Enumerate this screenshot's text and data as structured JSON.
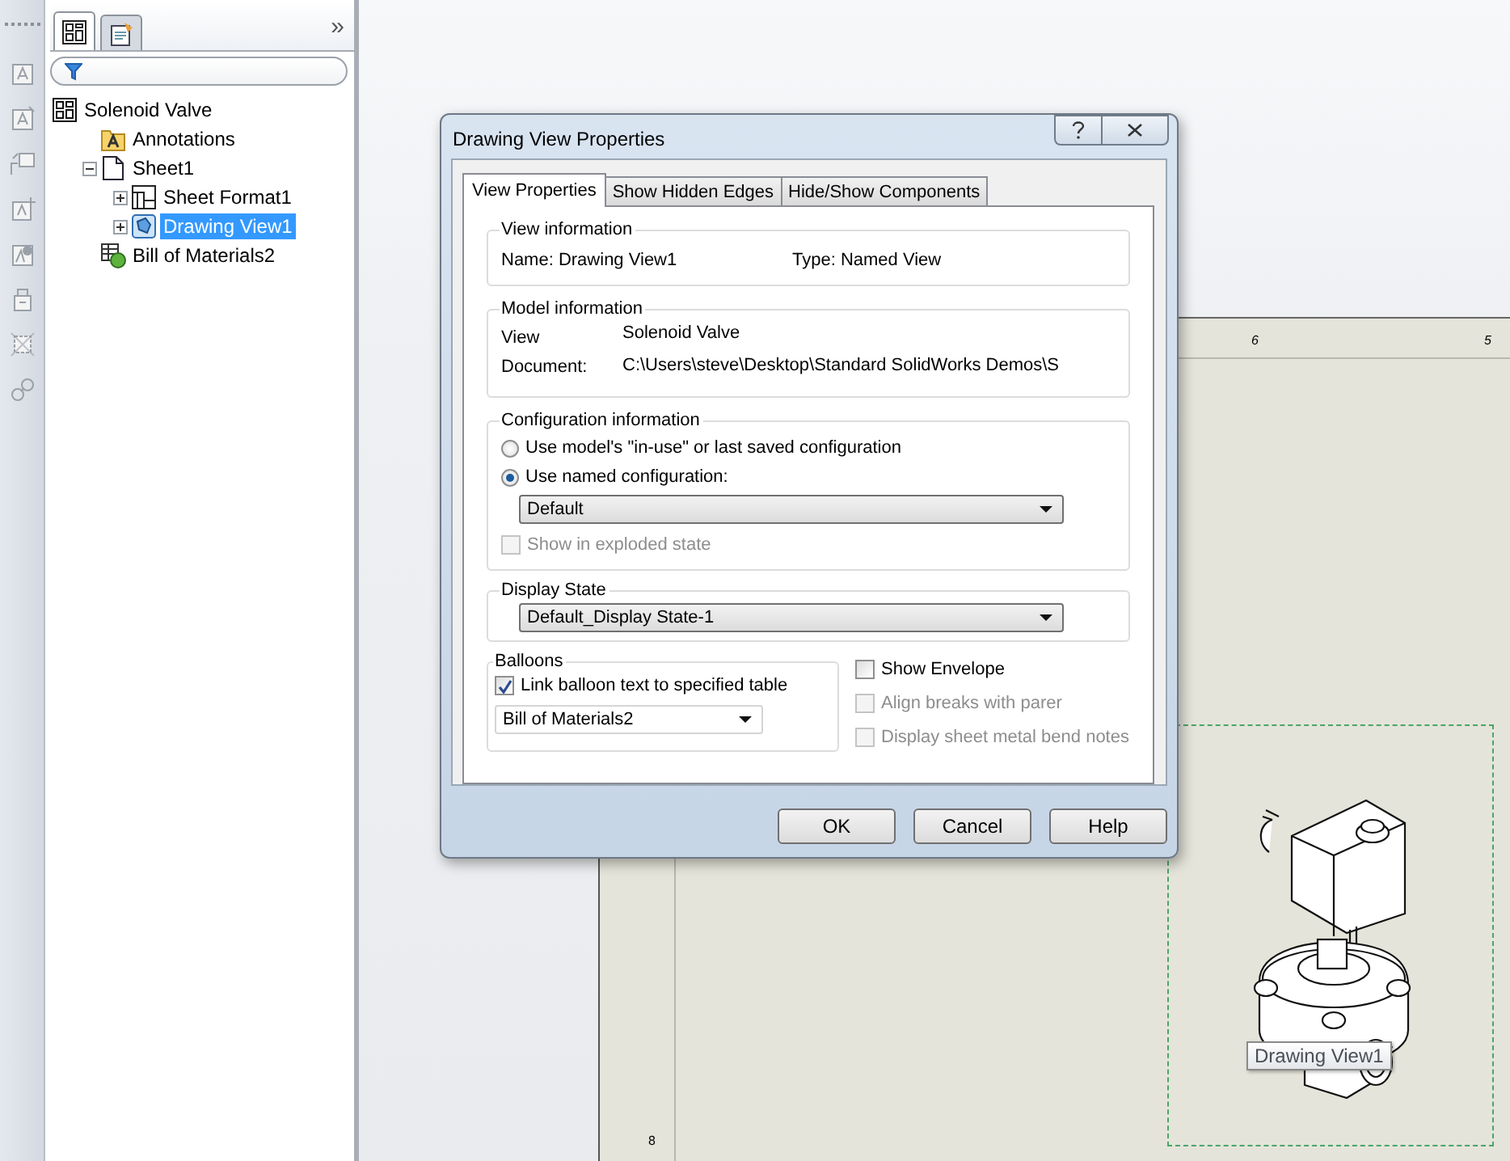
{
  "toolstrip": {
    "tools": [
      {
        "disabled": true
      },
      {
        "disabled": true
      },
      {
        "disabled": true
      },
      {
        "disabled": true
      },
      {
        "disabled": true
      },
      {
        "disabled": true
      },
      {
        "disabled": true
      },
      {
        "disabled": true
      }
    ]
  },
  "tree_panel": {
    "tabs": [
      {
        "kind": "tree",
        "selected": true
      },
      {
        "kind": "properties",
        "selected": false
      }
    ],
    "more": "»",
    "items": [
      {
        "label": "Solenoid Valve",
        "kind": "drawing",
        "selected": false,
        "children": [
          {
            "label": "Annotations",
            "kind": "annotations",
            "selected": false
          },
          {
            "label": "Sheet1",
            "kind": "sheet",
            "selected": false,
            "expanded": true,
            "children": [
              {
                "label": "Sheet Format1",
                "kind": "format",
                "selected": false,
                "expanded": false
              },
              {
                "label": "Drawing View1",
                "kind": "view",
                "selected": true,
                "expanded": false
              }
            ]
          },
          {
            "label": "Bill of Materials2",
            "kind": "bom",
            "selected": false
          }
        ]
      }
    ]
  },
  "sheet": {
    "top_ruler": [
      "6",
      "5"
    ],
    "left_ruler": [
      "8"
    ],
    "view_tooltip": "Drawing View1"
  },
  "dialog": {
    "title": "Drawing View Properties",
    "tabs": [
      {
        "label": "View Properties",
        "selected": true
      },
      {
        "label": "Show Hidden Edges",
        "selected": false
      },
      {
        "label": "Hide/Show Components",
        "selected": false
      }
    ],
    "view_information": {
      "title": "View information",
      "name": "Name: Drawing View1",
      "type": "Type: Named View"
    },
    "model_information": {
      "title": "Model information",
      "labels": [
        "View",
        "Document:"
      ],
      "model": "Solenoid Valve",
      "document": "C:\\Users\\steve\\Desktop\\Standard SolidWorks Demos\\S"
    },
    "configuration_information": {
      "title": "Configuration information",
      "options": [
        {
          "label": "Use model's \"in-use\" or last saved configuration",
          "selected": false
        },
        {
          "label": "Use named configuration:",
          "selected": true
        }
      ],
      "configuration": "Default",
      "exploded": {
        "label": "Show in exploded state",
        "checked": false,
        "disabled": true
      }
    },
    "display_state": {
      "title": "Display State",
      "value": "Default_Display State-1"
    },
    "balloons": {
      "title": "Balloons",
      "link": {
        "label": "Link balloon text to specified table",
        "checked": true,
        "disabled": false
      },
      "table": "Bill of Materials2"
    },
    "options": [
      {
        "label": "Show Envelope",
        "checked": false,
        "disabled": false
      },
      {
        "label": "Align breaks with parer",
        "checked": false,
        "disabled": true
      },
      {
        "label": "Display sheet metal bend notes",
        "checked": false,
        "disabled": true
      }
    ],
    "buttons": [
      "OK",
      "Cancel",
      "Help"
    ]
  }
}
